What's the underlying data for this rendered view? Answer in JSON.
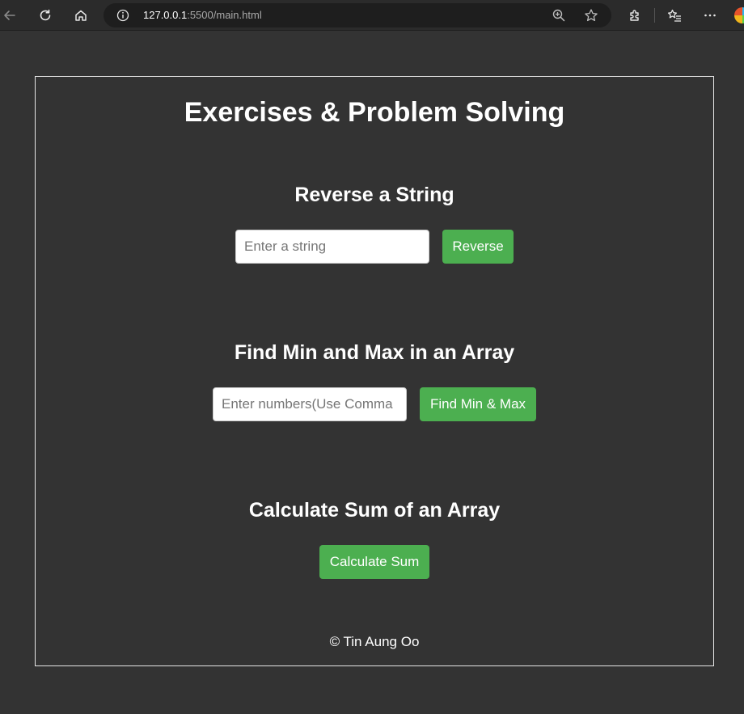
{
  "browser": {
    "url_host": "127.0.0.1",
    "url_rest": ":5500/main.html"
  },
  "page": {
    "title": "Exercises & Problem Solving",
    "reverse": {
      "heading": "Reverse a String",
      "input_placeholder": "Enter a string",
      "input_value": "",
      "button_label": "Reverse"
    },
    "minmax": {
      "heading": "Find Min and Max in an Array",
      "input_placeholder": "Enter numbers(Use Comma",
      "input_value": "",
      "button_label": "Find Min & Max"
    },
    "sum": {
      "heading": "Calculate Sum of an Array",
      "button_label": "Calculate Sum"
    },
    "footer": "© Tin Aung Oo"
  },
  "colors": {
    "page_background": "#333333",
    "button_green": "#4caf50",
    "text": "#ffffff"
  }
}
